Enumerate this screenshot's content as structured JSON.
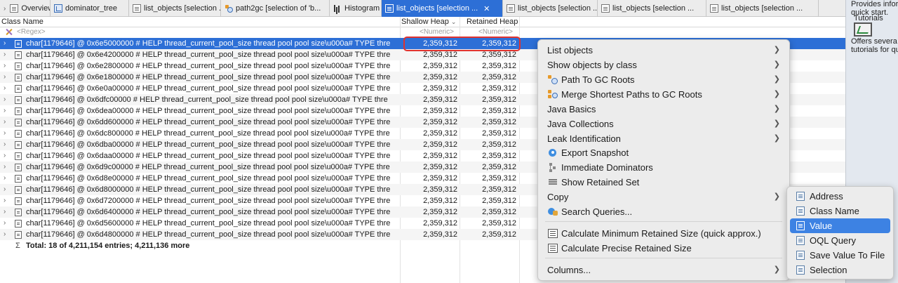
{
  "tabs": [
    {
      "label": "Overview",
      "icon": "info-icon",
      "width": 72
    },
    {
      "label": "dominator_tree",
      "icon": "tree-icon",
      "width": 112
    },
    {
      "label": "list_objects  [selection ...",
      "icon": "doc-icon",
      "width": 131
    },
    {
      "label": "path2gc  [selection of 'b...",
      "icon": "path-gc-icon",
      "width": 155
    },
    {
      "label": "Histogram",
      "icon": "histogram-icon",
      "width": 74
    },
    {
      "label": "list_objects  [selection ...",
      "icon": "doc-icon",
      "width": 173,
      "active": true
    },
    {
      "label": "list_objects  [selection ...",
      "icon": "doc-icon",
      "width": 135
    },
    {
      "label": "list_objects  [selection ...",
      "icon": "doc-icon",
      "width": 155
    },
    {
      "label": "list_objects  [selection ...",
      "icon": "doc-icon",
      "width": 160
    }
  ],
  "columns": {
    "class_name": "Class Name",
    "shallow_heap": "Shallow Heap",
    "retained_heap": "Retained Heap"
  },
  "filter": {
    "regex": "<Regex>",
    "numeric": "<Numeric>"
  },
  "rows": [
    {
      "name": "char[1179646] @ 0x6e5000000  # HELP thread_current_pool_size thread pool pool size\\u000a# TYPE thre",
      "shallow": "2,359,312",
      "retained": "2,359,312",
      "selected": true
    },
    {
      "name": "char[1179646] @ 0x6e4200000  # HELP thread_current_pool_size thread pool pool size\\u000a# TYPE thre",
      "shallow": "2,359,312",
      "retained": "2,359,312"
    },
    {
      "name": "char[1179646] @ 0x6e2800000  # HELP thread_current_pool_size thread pool pool size\\u000a# TYPE thre",
      "shallow": "2,359,312",
      "retained": "2,359,312"
    },
    {
      "name": "char[1179646] @ 0x6e1800000  # HELP thread_current_pool_size thread pool pool size\\u000a# TYPE thre",
      "shallow": "2,359,312",
      "retained": "2,359,312"
    },
    {
      "name": "char[1179646] @ 0x6e0a00000  # HELP thread_current_pool_size thread pool pool size\\u000a# TYPE thre",
      "shallow": "2,359,312",
      "retained": "2,359,312"
    },
    {
      "name": "char[1179646] @ 0x6dfc00000  # HELP thread_current_pool_size thread pool pool size\\u000a# TYPE thre",
      "shallow": "2,359,312",
      "retained": "2,359,312"
    },
    {
      "name": "char[1179646] @ 0x6dea00000  # HELP thread_current_pool_size thread pool pool size\\u000a# TYPE thre",
      "shallow": "2,359,312",
      "retained": "2,359,312"
    },
    {
      "name": "char[1179646] @ 0x6dd600000  # HELP thread_current_pool_size thread pool pool size\\u000a# TYPE thre",
      "shallow": "2,359,312",
      "retained": "2,359,312"
    },
    {
      "name": "char[1179646] @ 0x6dc800000  # HELP thread_current_pool_size thread pool pool size\\u000a# TYPE thre",
      "shallow": "2,359,312",
      "retained": "2,359,312"
    },
    {
      "name": "char[1179646] @ 0x6dba00000  # HELP thread_current_pool_size thread pool pool size\\u000a# TYPE thre",
      "shallow": "2,359,312",
      "retained": "2,359,312"
    },
    {
      "name": "char[1179646] @ 0x6daa00000  # HELP thread_current_pool_size thread pool pool size\\u000a# TYPE thre",
      "shallow": "2,359,312",
      "retained": "2,359,312"
    },
    {
      "name": "char[1179646] @ 0x6d9c00000  # HELP thread_current_pool_size thread pool pool size\\u000a# TYPE thre",
      "shallow": "2,359,312",
      "retained": "2,359,312"
    },
    {
      "name": "char[1179646] @ 0x6d8e00000  # HELP thread_current_pool_size thread pool pool size\\u000a# TYPE thre",
      "shallow": "2,359,312",
      "retained": "2,359,312"
    },
    {
      "name": "char[1179646] @ 0x6d8000000  # HELP thread_current_pool_size thread pool pool size\\u000a# TYPE thre",
      "shallow": "2,359,312",
      "retained": "2,359,312"
    },
    {
      "name": "char[1179646] @ 0x6d7200000  # HELP thread_current_pool_size thread pool pool size\\u000a# TYPE thre",
      "shallow": "2,359,312",
      "retained": "2,359,312"
    },
    {
      "name": "char[1179646] @ 0x6d6400000  # HELP thread_current_pool_size thread pool pool size\\u000a# TYPE thre",
      "shallow": "2,359,312",
      "retained": "2,359,312"
    },
    {
      "name": "char[1179646] @ 0x6d5600000  # HELP thread_current_pool_size thread pool pool size\\u000a# TYPE thre",
      "shallow": "2,359,312",
      "retained": "2,359,312"
    },
    {
      "name": "char[1179646] @ 0x6d4800000  # HELP thread_current_pool_size thread pool pool size\\u000a# TYPE thre",
      "shallow": "2,359,312",
      "retained": "2,359,312"
    }
  ],
  "total": "Total: 18 of 4,211,154 entries; 4,211,136 more",
  "context_menu": {
    "items": [
      {
        "label": "List objects",
        "submenu": true
      },
      {
        "label": "Show objects by class",
        "submenu": true
      },
      {
        "label": "Path To GC Roots",
        "icon": "path-gc-icon",
        "submenu": true
      },
      {
        "label": "Merge Shortest Paths to GC Roots",
        "icon": "merge-paths-icon",
        "submenu": true
      },
      {
        "label": "Java Basics",
        "submenu": true
      },
      {
        "label": "Java Collections",
        "submenu": true
      },
      {
        "label": "Leak Identification",
        "submenu": true
      },
      {
        "label": "Export Snapshot",
        "icon": "export-snapshot-icon"
      },
      {
        "label": "Immediate Dominators",
        "icon": "dominators-icon"
      },
      {
        "label": "Show Retained Set",
        "icon": "retained-set-icon"
      },
      {
        "label": "Copy",
        "submenu": true,
        "highlighted": true
      },
      {
        "label": "Search Queries...",
        "icon": "search-queries-icon"
      },
      {
        "label": "Calculate Minimum Retained Size (quick approx.)",
        "icon": "calculator-icon"
      },
      {
        "label": "Calculate Precise Retained Size",
        "icon": "calculator-icon"
      },
      {
        "label": "Columns...",
        "submenu": true
      }
    ]
  },
  "copy_submenu": {
    "items": [
      {
        "label": "Address"
      },
      {
        "label": "Class Name"
      },
      {
        "label": "Value",
        "selected": true
      },
      {
        "label": "OQL Query"
      },
      {
        "label": "Save Value To File"
      },
      {
        "label": "Selection"
      }
    ]
  },
  "side_panel": {
    "line1": "Provides infor",
    "line2": "quick start.",
    "line3": "Tutorials",
    "line4": "Offers severa",
    "line5": "tutorials for qu"
  },
  "colors": {
    "selection": "#2d6fd6",
    "highlight_box": "#e0332f",
    "menu_bg": "#ececec",
    "submenu_selected": "#3d82e3"
  }
}
